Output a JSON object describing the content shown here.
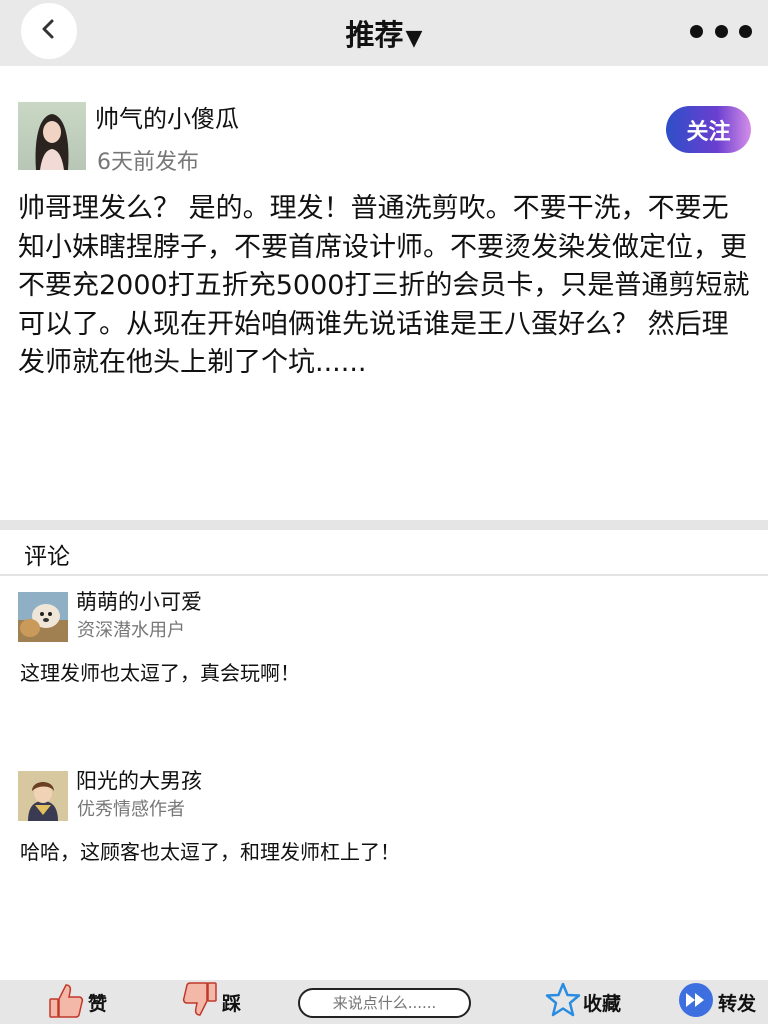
{
  "header": {
    "title": "推荐",
    "caret": "▼"
  },
  "post": {
    "author_name": "帅气的小傻瓜",
    "time": "6天前发布",
    "follow_label": "关注",
    "content": "帅哥理发么？ 是的。理发！普通洗剪吹。不要干洗，不要无知小妹瞎捏脖子，不要首席设计师。不要烫发染发做定位，更不要充2000打五折充5000打三折的会员卡，只是普通剪短就可以了。从现在开始咱俩谁先说话谁是王八蛋好么？ 然后理发师就在他头上剃了个坑......"
  },
  "comments_section": {
    "heading": "评论",
    "items": [
      {
        "name": "萌萌的小可爱",
        "level": "资深潜水用户",
        "text": "这理发师也太逗了，真会玩啊！"
      },
      {
        "name": "阳光的大男孩",
        "level": "优秀情感作者",
        "text": "哈哈，这顾客也太逗了，和理发师杠上了！"
      }
    ]
  },
  "bottom_bar": {
    "like_label": "赞",
    "dislike_label": "踩",
    "comment_placeholder": "来说点什么......",
    "favorite_label": "收藏",
    "share_label": "转发"
  },
  "colors": {
    "header_bg": "#e9e9e9",
    "follow_gradient_start": "#2d4fc8",
    "follow_gradient_end": "#d58ee8",
    "star_blue": "#2a8ce0",
    "share_blue": "#3d6fe0",
    "thumb_pink": "#f3b8a8"
  }
}
